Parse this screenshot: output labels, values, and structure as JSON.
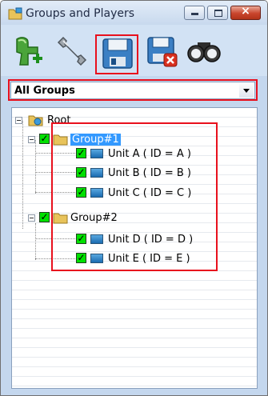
{
  "window": {
    "title": "Groups and Players"
  },
  "titlebar_buttons": {
    "close_glyph": "×"
  },
  "toolbar": {
    "buttons": [
      {
        "name": "add-player-button",
        "icon": "add-player-icon"
      },
      {
        "name": "settings-button",
        "icon": "wrench-icon"
      },
      {
        "name": "save-button",
        "icon": "floppy-disk-icon"
      },
      {
        "name": "discard-button",
        "icon": "floppy-disk-delete-icon"
      },
      {
        "name": "find-button",
        "icon": "binoculars-icon"
      }
    ]
  },
  "filter": {
    "selected": "All Groups"
  },
  "tree": {
    "root": "Root",
    "groups": [
      {
        "label": "Group#1",
        "selected": true,
        "checked": true,
        "units": [
          "Unit A ( ID = A )",
          "Unit B ( ID = B )",
          "Unit C ( ID = C )"
        ]
      },
      {
        "label": "Group#2",
        "selected": false,
        "checked": true,
        "units": [
          "Unit D ( ID = D )",
          "Unit E ( ID = E )"
        ]
      }
    ],
    "check_glyph": "✓"
  },
  "colors": {
    "highlight_border": "#e8101d",
    "selection": "#3399ff",
    "checkbox": "#00e000"
  }
}
